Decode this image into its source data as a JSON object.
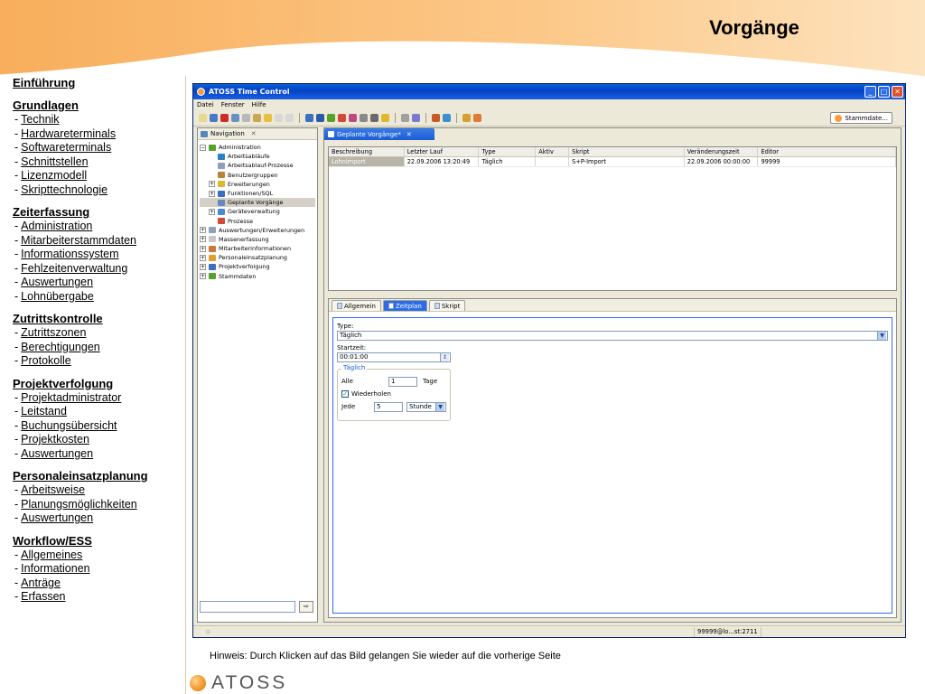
{
  "slide": {
    "title": "Vorgänge",
    "hint": "Hinweis: Durch Klicken auf das Bild gelangen Sie wieder auf die vorherige Seite",
    "logo_text": "ATOSS",
    "accent_color": "#f6a54a"
  },
  "outline": [
    {
      "heading": "Einführung",
      "items": []
    },
    {
      "heading": "Grundlagen",
      "items": [
        "Technik",
        "Hardwareterminals",
        "Softwareterminals",
        "Schnittstellen",
        "Lizenzmodell",
        "Skripttechnologie"
      ]
    },
    {
      "heading": "Zeiterfassung",
      "items": [
        "Administration",
        "Mitarbeiterstammdaten",
        "Informationssystem",
        "Fehlzeitenverwaltung",
        "Auswertungen",
        "Lohnübergabe"
      ]
    },
    {
      "heading": "Zutrittskontrolle",
      "items": [
        "Zutrittszonen",
        "Berechtigungen",
        "Protokolle"
      ]
    },
    {
      "heading": "Projektverfolgung",
      "items": [
        "Projektadministrator",
        "Leitstand",
        "Buchungsübersicht",
        "Projektkosten",
        "Auswertungen"
      ]
    },
    {
      "heading": "Personaleinsatzplanung",
      "items": [
        "Arbeitsweise",
        "Planungsmöglichkeiten",
        "Auswertungen"
      ]
    },
    {
      "heading": "Workflow/ESS",
      "items": [
        "Allgemeines",
        "Informationen",
        "Anträge",
        "Erfassen"
      ]
    }
  ],
  "app": {
    "title": "ATOSS Time Control",
    "menu": [
      "Datei",
      "Fenster",
      "Hilfe"
    ],
    "stammdaten_button": "Stammdate...",
    "nav": {
      "tab_label": "Navigation",
      "tree": [
        {
          "label": "Administration",
          "level": 0,
          "toggle": "−",
          "color": "#5aa02c"
        },
        {
          "label": "Arbeitsabläufe",
          "level": 1,
          "toggle": "",
          "color": "#2f7fbf"
        },
        {
          "label": "Arbeitsablauf-Prozesse",
          "level": 1,
          "toggle": "",
          "color": "#8fa0b8"
        },
        {
          "label": "Benutzergruppen",
          "level": 1,
          "toggle": "",
          "color": "#b8843c"
        },
        {
          "label": "Erweiterungen",
          "level": 1,
          "toggle": "+",
          "color": "#e0b830"
        },
        {
          "label": "Funktionen/SQL",
          "level": 1,
          "toggle": "+",
          "color": "#3a6fc0"
        },
        {
          "label": "Geplante Vorgänge",
          "level": 1,
          "toggle": "",
          "color": "#6a86c0",
          "selected": true
        },
        {
          "label": "Geräteverwaltung",
          "level": 1,
          "toggle": "+",
          "color": "#4a8ad0"
        },
        {
          "label": "Prozesse",
          "level": 1,
          "toggle": "",
          "color": "#d04a3a"
        },
        {
          "label": "Auswertungen/Erweiterungen",
          "level": 0,
          "toggle": "+",
          "color": "#8fa0b8"
        },
        {
          "label": "Massenerfassung",
          "level": 0,
          "toggle": "+",
          "color": "#c8c8c8"
        },
        {
          "label": "Mitarbeiterinformationen",
          "level": 0,
          "toggle": "+",
          "color": "#c87a3c"
        },
        {
          "label": "Personaleinsatzplanung",
          "level": 0,
          "toggle": "+",
          "color": "#e0a030"
        },
        {
          "label": "Projektverfolgung",
          "level": 0,
          "toggle": "+",
          "color": "#3a70c0"
        },
        {
          "label": "Stammdaten",
          "level": 0,
          "toggle": "+",
          "color": "#5aa02c"
        }
      ]
    },
    "editor": {
      "tab_label": "Geplante Vorgänge*",
      "columns": [
        "Beschreibung",
        "Letzter Lauf",
        "Type",
        "Aktiv",
        "Skript",
        "Veränderungszeit",
        "Editor"
      ],
      "rows": [
        [
          "Lohnimport",
          "22.09.2006 13:20:49",
          "Täglich",
          "",
          "S+P-Import",
          "22.09.2006 00:00:00",
          "99999"
        ]
      ],
      "detail_tabs": [
        "Allgemein",
        "Zeitplan",
        "Skript"
      ],
      "form": {
        "type_label": "Type:",
        "type_value": "Täglich",
        "start_label": "Startzeit:",
        "start_value": "00:01:00",
        "group_title": "Täglich",
        "alle_label": "Alle",
        "alle_value": "1",
        "tage_label": "Tage",
        "wiederholen_label": "Wiederholen",
        "jede_label": "Jede",
        "jede_value": "5",
        "unit_value": "Stunde"
      }
    },
    "status_user": "99999@lo...st:2711"
  }
}
